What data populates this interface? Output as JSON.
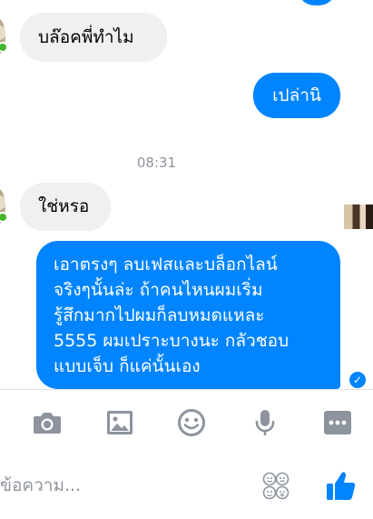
{
  "conversation": {
    "messages": [
      {
        "direction": "incoming",
        "text": "บล๊อคพี่ทำไม"
      },
      {
        "direction": "outgoing",
        "text": "เปล่านิ"
      },
      {
        "direction": "incoming",
        "text": "ใช่หรอ"
      },
      {
        "direction": "outgoing",
        "lines": [
          "เอาตรงๆ ลบเฟสและบล็อกไลน์",
          "จริงๆนั้นล่ะ ถ้าคนไหนผมเริ่ม",
          "รู้สึกมากไปผมก็ลบหมดแหละ",
          "5555 ผมเปราะบางนะ กลัวชอบ",
          "แบบเจ็บ ก็แค่นั้นเอง"
        ]
      }
    ],
    "timestamp": "08:31",
    "seen_mark": "✓"
  },
  "toolbar": {
    "icons": [
      "camera-icon",
      "image-icon",
      "emoji-icon",
      "microphone-icon",
      "more-icon"
    ]
  },
  "composer": {
    "placeholder": "ข้อความ..."
  },
  "colors": {
    "accent": "#0084ff",
    "incoming_bubble": "#f1f0f0",
    "icon_gray": "#8d949e"
  }
}
